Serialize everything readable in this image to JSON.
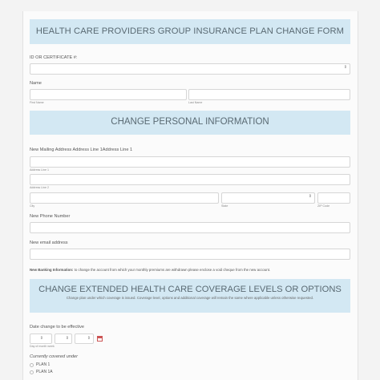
{
  "form": {
    "title": "HEALTH CARE PROVIDERS GROUP INSURANCE PLAN CHANGE FORM",
    "id_label": "ID OR CERTIFICATE #:",
    "name_label": "Name",
    "first_name_sub": "First Name",
    "last_name_sub": "Last Name",
    "section2_title": "CHANGE PERSONAL INFORMATION",
    "address_label": "New Mailing Address Address Line 1Address Line 1",
    "address_line1_sub": "Address Line 1",
    "address_line2_sub": "Address Line 2",
    "city_sub": "City",
    "state_sub": "State",
    "zip_sub": "ZIP Code",
    "phone_label": "New Phone Number",
    "email_label": "New email address",
    "banking_bold": "New Banking Information:",
    "banking_text": " to change the account from which your monthly premiums are withdrawn please enclose a void cheque from the new account.",
    "section3_title": "CHANGE EXTENDED HEALTH CARE COVERAGE LEVELS OR OPTIONS",
    "section3_sub": "Change plan under which coverage is issued. Coverage level, options and additional coverage will remain the same where applicable unless otherwise requested.",
    "date_label": "Date change to be effective",
    "date_sub": "Day of month week",
    "currently_label": "Currently covered under",
    "plans": [
      "PLAN 1",
      "PLAN 1A"
    ]
  },
  "colors": {
    "banner": "#d3e8f3",
    "calendar_icon": "#cc5555"
  }
}
